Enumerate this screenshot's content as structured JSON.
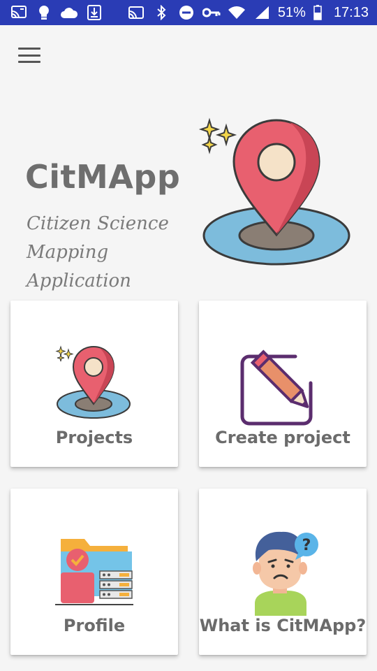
{
  "status_bar": {
    "battery": "51%",
    "time": "17:13",
    "icons": [
      "cast-icon",
      "lightbulb-icon",
      "cloud-icon",
      "download-icon",
      "screencast-icon",
      "bluetooth-icon",
      "do-not-disturb-icon",
      "vpn-key-icon",
      "wifi-icon",
      "signal-icon",
      "battery-icon"
    ]
  },
  "header": {
    "menu_icon": "hamburger-menu-icon"
  },
  "hero": {
    "title": "CitMApp",
    "subtitle": "Citizen Science Mapping Application",
    "image_icon": "map-pin-icon"
  },
  "cards": [
    {
      "label": "Projects",
      "icon": "map-pin-icon"
    },
    {
      "label": "Create project",
      "icon": "edit-icon"
    },
    {
      "label": "Profile",
      "icon": "profile-folder-icon"
    },
    {
      "label": "What is CitMApp?",
      "icon": "confused-person-icon"
    }
  ],
  "colors": {
    "status_bar": "#2a3cb5",
    "pin": "#e8606f",
    "ring": "#7dbcdc",
    "text": "#6b6b6b",
    "pencil_frame": "#5b2d6e"
  }
}
